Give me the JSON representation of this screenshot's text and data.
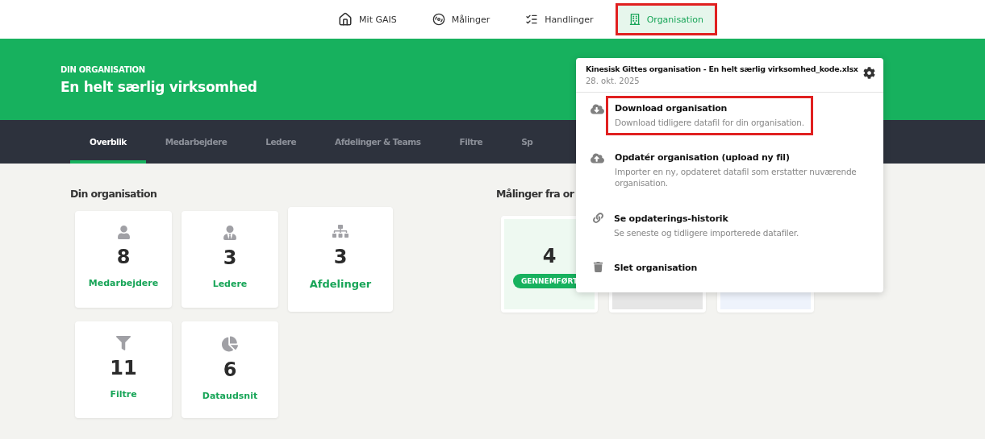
{
  "top_nav": [
    {
      "label": "Mit GAIS",
      "selected": false,
      "annotated": false
    },
    {
      "label": "Målinger",
      "selected": false,
      "annotated": false
    },
    {
      "label": "Handlinger",
      "selected": false,
      "annotated": false
    },
    {
      "label": "Organisation",
      "selected": true,
      "annotated": true
    }
  ],
  "header": {
    "eyebrow": "DIN ORGANISATION",
    "title": "En helt særlig virksomhed"
  },
  "tabs": [
    {
      "label": "Overblik",
      "selected": true
    },
    {
      "label": "Medarbejdere",
      "selected": false
    },
    {
      "label": "Ledere",
      "selected": false
    },
    {
      "label": "Afdelinger & Teams",
      "selected": false
    },
    {
      "label": "Filtre",
      "selected": false
    },
    {
      "label": "Sp",
      "selected": false
    }
  ],
  "organisation": {
    "heading": "Din organisation",
    "stats": [
      {
        "kind": "person",
        "value": "8",
        "label": "Medarbejdere",
        "highlighted": false
      },
      {
        "kind": "leader",
        "value": "3",
        "label": "Ledere",
        "highlighted": false
      },
      {
        "kind": "sitemap",
        "value": "3",
        "label": "Afdelinger",
        "highlighted": true
      },
      {
        "kind": "filter",
        "value": "11",
        "label": "Filtre",
        "highlighted": false
      },
      {
        "kind": "pie",
        "value": "6",
        "label": "Dataudsnit",
        "highlighted": false
      }
    ]
  },
  "measurements": {
    "heading": "Målinger fra or",
    "cards": [
      {
        "kind": "done",
        "value": "4",
        "badge": "GENNEMFØRT"
      },
      {
        "kind": "grey"
      },
      {
        "kind": "blue"
      }
    ]
  },
  "dropdown": {
    "title": "Kinesisk Gittes organisation - En helt særlig virksomhed_kode.xlsx",
    "date": "28. okt. 2025",
    "items": [
      {
        "kind": "download",
        "title": "Download organisation",
        "description": "Download tidligere datafil for din organisation.",
        "annotated": true
      },
      {
        "kind": "upload",
        "title": "Opdatér organisation (upload ny fil)",
        "description": "Importer en ny, opdateret datafil som erstatter nuværende organisation.",
        "annotated": false
      },
      {
        "kind": "link",
        "title": "Se opdaterings-historik",
        "description": "Se seneste og tidligere importerede datafiler.",
        "annotated": false
      },
      {
        "kind": "delete",
        "title": "Slet organisation",
        "annotated": false
      }
    ]
  }
}
